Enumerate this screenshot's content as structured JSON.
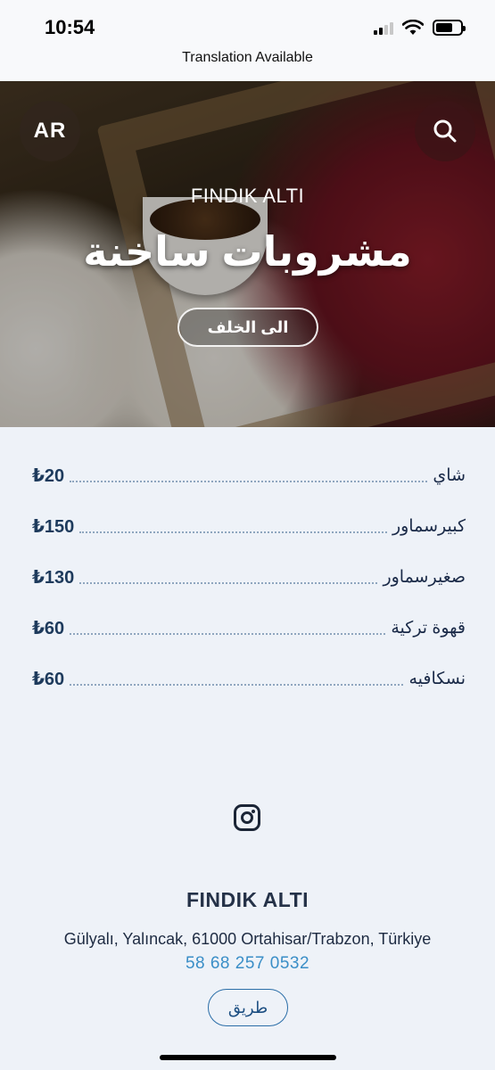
{
  "status_bar": {
    "time": "10:54"
  },
  "banner": {
    "text": "Translation Available"
  },
  "hero": {
    "lang_label": "AR",
    "brand": "FINDIK ALTI",
    "title": "مشروبات ساخنة",
    "back_label": "الى الخلف"
  },
  "menu": {
    "items": [
      {
        "name": "شاي",
        "price": "₺20"
      },
      {
        "name": "كبيرسماور",
        "price": "₺150"
      },
      {
        "name": "صغيرسماور",
        "price": "₺130"
      },
      {
        "name": "قهوة تركية",
        "price": "₺60"
      },
      {
        "name": "نسكافيه",
        "price": "₺60"
      }
    ]
  },
  "footer": {
    "social_icon": "instagram-icon",
    "name": "FINDIK ALTI",
    "address": "Gülyalı, Yalıncak, 61000 Ortahisar/Trabzon, Türkiye",
    "phone": "58 68 257 0532",
    "directions_label": "طريق"
  },
  "colors": {
    "background": "#eef2f8",
    "price": "#1d3a5c",
    "phone": "#3a8ec7",
    "accent_border": "#2b6ea8"
  }
}
